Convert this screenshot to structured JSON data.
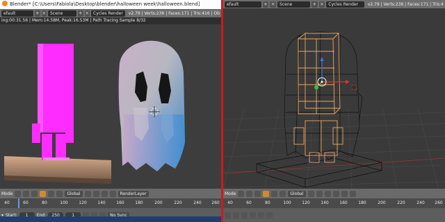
{
  "window": {
    "title": "Blender* [C:\\Users\\Fabiola\\Desktop\\blender\\halloween week\\halloween.blend]"
  },
  "left_header": {
    "layout": "efault",
    "scene": "Scene",
    "engine": "Cycles Render",
    "stats": "v2.79 | Verts:236 | Faces:171 | Tris:416 | Ob"
  },
  "render_info": "ing:00:31.56 | Mem:14.58M, Peak:16.53M | Path Tracing Sample 8/32",
  "right_header": {
    "layout": "efault",
    "scene": "Scene",
    "engine": "Cycles Render",
    "stats": "v2.79 | Verts:236 | Faces:171 | Tris:4"
  },
  "left_viewport_header": {
    "mode": "Mode",
    "orientation": "Global",
    "layer": "RenderLayer"
  },
  "right_viewport_header": {
    "mode": "Mode",
    "orientation": "Global"
  },
  "left_ruler": [
    "40",
    "60",
    "80",
    "100",
    "120",
    "140",
    "160",
    "180",
    "200",
    "220",
    "240",
    "260"
  ],
  "right_ruler": [
    "40",
    "60",
    "80",
    "100",
    "120",
    "140",
    "160",
    "180",
    "200",
    "220",
    "240",
    "260"
  ],
  "timeline": {
    "start_label": "Start:",
    "start": "1",
    "end_label": "End:",
    "end": "250",
    "current": "1",
    "sync": "No Sync"
  },
  "colors": {
    "blender_orange": "#f08a1c",
    "magenta_object": "#ff2cff",
    "divider_red": "#d4161f",
    "timeline_cursor": "#5aa0e8",
    "selection_orange": "#e8a860"
  },
  "icons": [
    "blender-logo-icon",
    "add-icon",
    "close-icon",
    "view-menu-icon",
    "transform-manipulator-icon",
    "3d-cursor-icon"
  ]
}
